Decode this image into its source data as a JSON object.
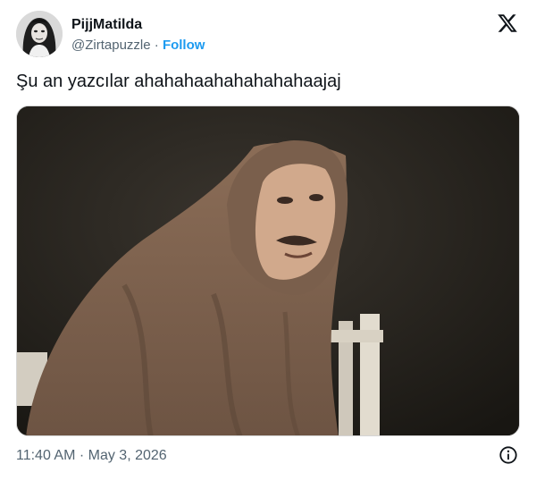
{
  "tweet": {
    "author": {
      "display_name": "PijjMatilda",
      "handle": "@Zirtapuzzle",
      "separator": "·",
      "follow_label": "Follow",
      "avatar_icon": "avatar-photo"
    },
    "platform_icon": "x-logo-icon",
    "text": "Şu an yazcılar ahahahaahahahahahaajaj",
    "media": {
      "kind": "photo",
      "icon": "man-wrapped-in-blanket-photo"
    },
    "timestamp": "11:40 AM · May 3, 2026",
    "info_icon": "info-icon"
  },
  "colors": {
    "text": "#0f1419",
    "secondary": "#536471",
    "link": "#1d9bf0",
    "background": "#ffffff"
  }
}
